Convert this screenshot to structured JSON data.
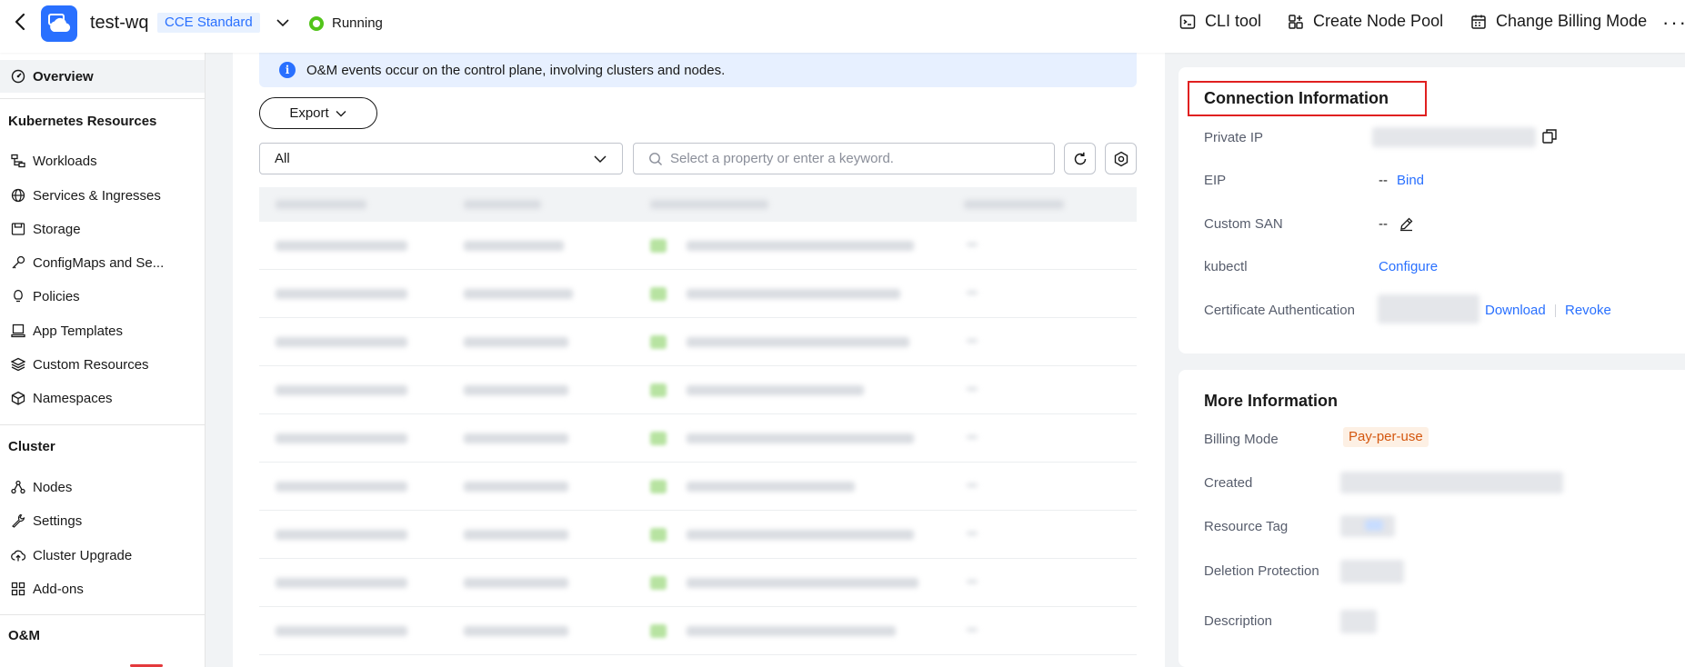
{
  "header": {
    "cluster_name": "test-wq",
    "edition": "CCE Standard",
    "status": "Running",
    "actions": [
      {
        "label": "CLI tool",
        "icon": "terminal-icon"
      },
      {
        "label": "Create Node Pool",
        "icon": "node-pool-icon"
      },
      {
        "label": "Change Billing Mode",
        "icon": "billing-icon"
      }
    ],
    "more": "···"
  },
  "sidebar": {
    "overview": "Overview",
    "sections": [
      {
        "title": "Kubernetes Resources",
        "items": [
          {
            "label": "Workloads",
            "icon": "workloads-icon"
          },
          {
            "label": "Services & Ingresses",
            "icon": "globe-icon"
          },
          {
            "label": "Storage",
            "icon": "storage-icon"
          },
          {
            "label": "ConfigMaps and Se...",
            "icon": "key-icon"
          },
          {
            "label": "Policies",
            "icon": "lightbulb-icon"
          },
          {
            "label": "App Templates",
            "icon": "template-icon"
          },
          {
            "label": "Custom Resources",
            "icon": "layers-icon"
          },
          {
            "label": "Namespaces",
            "icon": "cube-icon"
          }
        ]
      },
      {
        "title": "Cluster",
        "items": [
          {
            "label": "Nodes",
            "icon": "nodes-icon"
          },
          {
            "label": "Settings",
            "icon": "wrench-icon"
          },
          {
            "label": "Cluster Upgrade",
            "icon": "cloud-upload-icon"
          },
          {
            "label": "Add-ons",
            "icon": "addons-icon"
          }
        ]
      },
      {
        "title": "O&M",
        "items": []
      }
    ]
  },
  "events": {
    "banner": "O&M events occur on the control plane, involving clusters and nodes.",
    "export_label": "Export",
    "filter_value": "All",
    "search_placeholder": "Select a property or enter a keyword."
  },
  "connection": {
    "title": "Connection Information",
    "rows": {
      "private_ip": "Private IP",
      "eip": "EIP",
      "eip_value": "--",
      "eip_action": "Bind",
      "custom_san": "Custom SAN",
      "custom_san_value": "--",
      "kubectl": "kubectl",
      "kubectl_action": "Configure",
      "cert_auth": "Certificate Authentication",
      "cert_download": "Download",
      "cert_revoke": "Revoke"
    }
  },
  "more_info": {
    "title": "More Information",
    "rows": {
      "billing_mode": "Billing Mode",
      "billing_value": "Pay-per-use",
      "created": "Created",
      "resource_tag": "Resource Tag",
      "deletion_protection": "Deletion Protection",
      "description": "Description"
    }
  },
  "colors": {
    "accent": "#2970ff",
    "running": "#52c41a",
    "highlight": "#e02020",
    "billing_badge": "#d4570f"
  }
}
